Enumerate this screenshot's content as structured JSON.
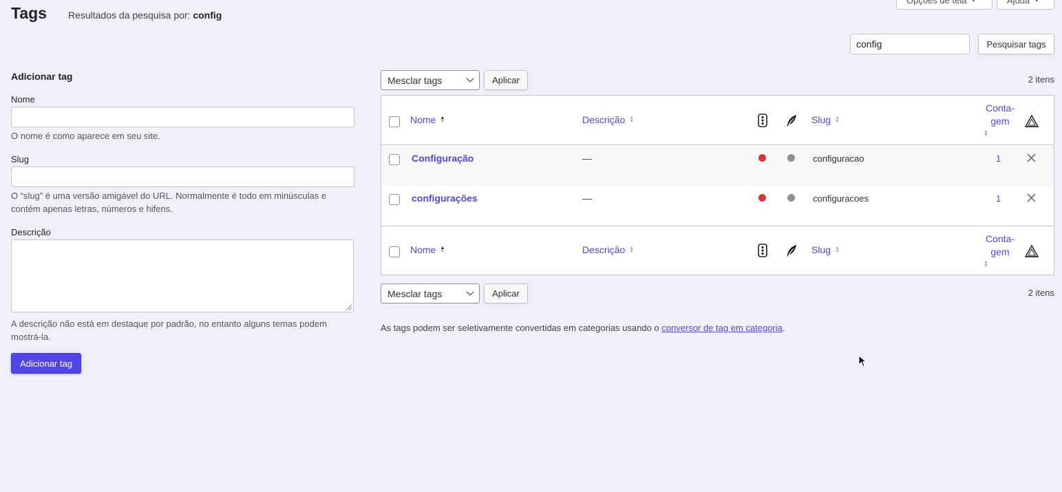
{
  "header": {
    "title": "Tags",
    "search_result_prefix": "Resultados da pesquisa por: ",
    "search_term": "config",
    "screen_options_label": "Opções de tela",
    "help_label": "Ajuda"
  },
  "search": {
    "value": "config",
    "button_label": "Pesquisar tags"
  },
  "add_form": {
    "heading": "Adicionar tag",
    "name_label": "Nome",
    "name_help": "O nome é como aparece em seu site.",
    "slug_label": "Slug",
    "slug_help": "O “slug” é uma versão amigável do URL. Normalmente é todo em minúsculas e contém apenas letras, números e hifens.",
    "description_label": "Descrição",
    "description_help": "A descrição não está em destaque por padrão, no entanto alguns temas podem mostrá-la.",
    "submit_label": "Adicionar tag"
  },
  "bulk": {
    "action_selected": "Mesclar tags",
    "apply_label": "Aplicar",
    "items_count": "2 itens"
  },
  "table": {
    "col_name": "Nome",
    "col_description": "Descrição",
    "col_slug": "Slug",
    "col_count_line1": "Conta-",
    "col_count_line2": "gem",
    "rows": [
      {
        "name": "Configuração",
        "description": "—",
        "slug": "configuracao",
        "count": "1"
      },
      {
        "name": "configurações",
        "description": "—",
        "slug": "configuracoes",
        "count": "1"
      }
    ]
  },
  "footer_note": {
    "prefix": "As tags podem ser seletivamente convertidas em categorias usando o ",
    "link": "conversor de tag em categoria",
    "suffix": "."
  },
  "colors": {
    "accent": "#4f46e5",
    "status_red": "#d63638",
    "status_grey": "#8c8f94",
    "background": "#f0f0f8"
  }
}
